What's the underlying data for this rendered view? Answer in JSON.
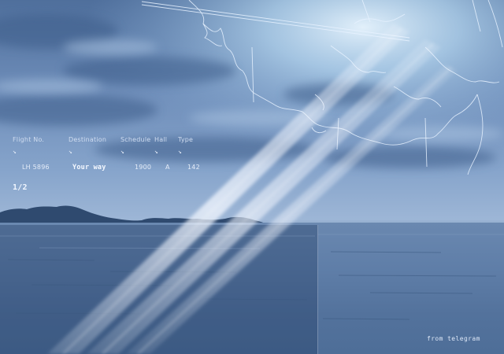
{
  "departure_board": {
    "headers": {
      "flight_no": "Flight No.",
      "destination": "Destination",
      "schedule": "Schedule",
      "hall": "Hall",
      "type": "Type"
    },
    "arrow_glyph": "↘",
    "row": {
      "flight_no": "LH 5896",
      "destination": "Your way",
      "schedule": "1900",
      "hall": "A",
      "type": "142"
    },
    "page_indicator": "1/2"
  },
  "credit": "from telegram",
  "colors": {
    "sky_top": "#4f6f9c",
    "horizon": "#9db6d6",
    "sea": "#5f7ea8",
    "map_lines": "#e8f2ff",
    "light_beam": "#f3f7ff"
  },
  "icons": {
    "board_arrows": "arrow-down-right-icon"
  }
}
